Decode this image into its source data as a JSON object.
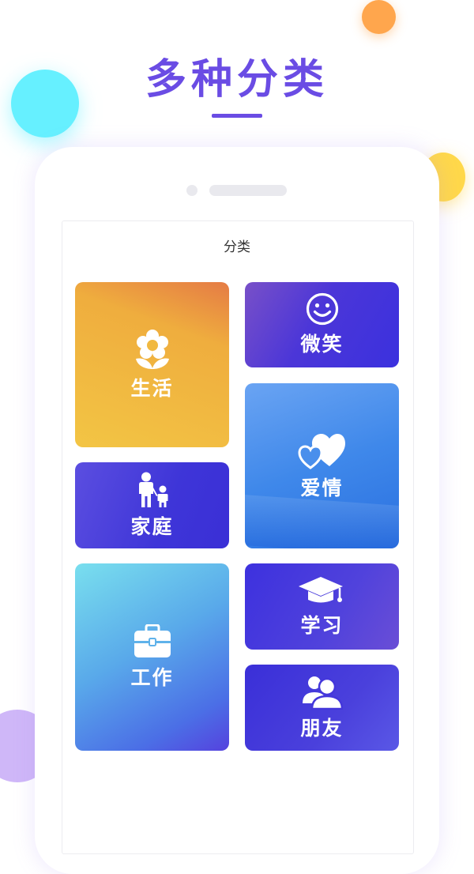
{
  "headline": "多种分类",
  "screen": {
    "title": "分类"
  },
  "categories": {
    "life": {
      "label": "生活",
      "icon": "flower-icon"
    },
    "smile": {
      "label": "微笑",
      "icon": "smile-icon"
    },
    "love": {
      "label": "爱情",
      "icon": "hearts-icon"
    },
    "family": {
      "label": "家庭",
      "icon": "family-icon"
    },
    "work": {
      "label": "工作",
      "icon": "briefcase-icon"
    },
    "study": {
      "label": "学习",
      "icon": "graduation-cap-icon"
    },
    "friend": {
      "label": "朋友",
      "icon": "friends-icon"
    }
  },
  "colors": {
    "accent": "#6a4ce4",
    "bubble_orange": "#ffa64d",
    "bubble_cyan": "#66f0ff",
    "bubble_yellow": "#ffd84a",
    "bubble_purple": "#c7aaf7"
  }
}
